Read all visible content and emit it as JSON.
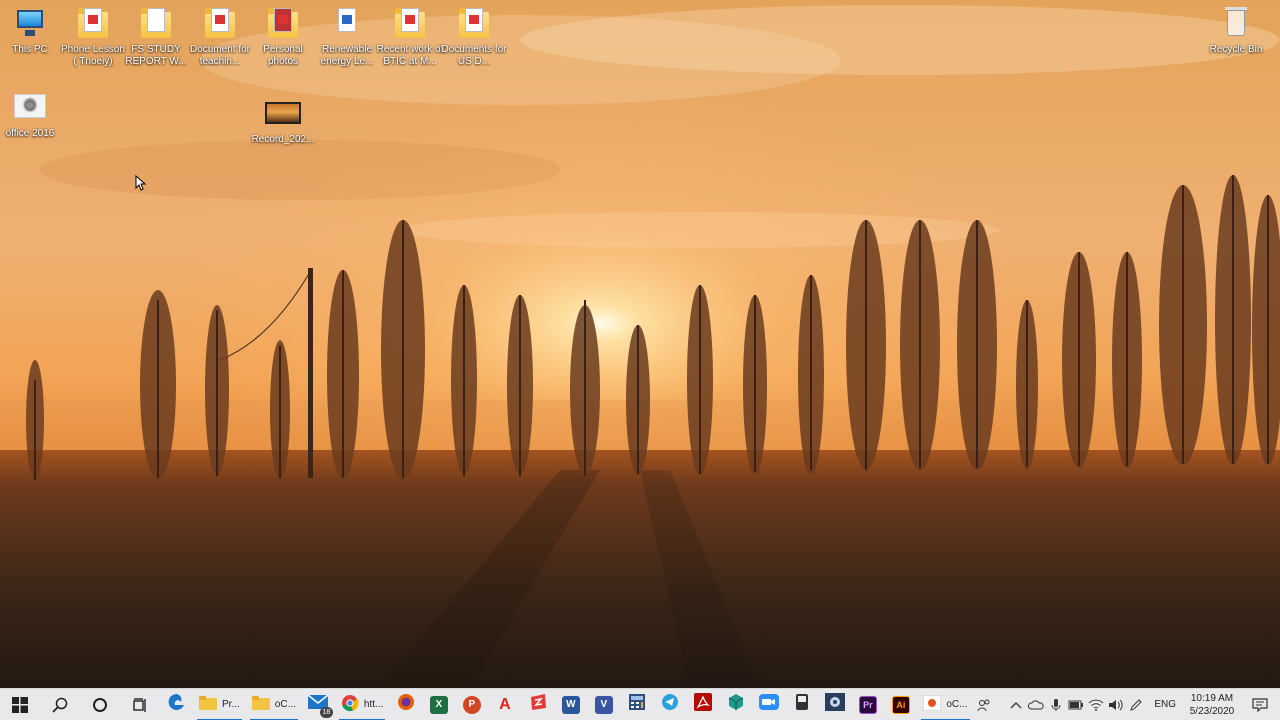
{
  "desktop": {
    "icons": [
      {
        "label": "This PC",
        "icon": "this-pc-icon"
      },
      {
        "label": "Phone Lesson ( Tnoeiy)",
        "icon": "pdf-document-icon"
      },
      {
        "label": "FS STUDY REPORT W...",
        "icon": "folder-icon"
      },
      {
        "label": "Document for teachin...",
        "icon": "pdf-document-icon"
      },
      {
        "label": "Personal photos",
        "icon": "photo-folder-icon"
      },
      {
        "label": "Renewable energy Le...",
        "icon": "word-document-icon"
      },
      {
        "label": "Recent work of BTIC at M...",
        "icon": "pdf-document-icon"
      },
      {
        "label": "Documents for US D...",
        "icon": "pdf-document-icon"
      },
      {
        "label": "office 2016",
        "icon": "office-setup-icon"
      },
      {
        "label": "Record_202...",
        "icon": "video-file-icon"
      },
      {
        "label": "Recycle Bin",
        "icon": "recycle-bin-icon"
      }
    ]
  },
  "taskbar": {
    "start": "windows-start-icon",
    "search": "search-icon",
    "cortana": "cortana-icon",
    "task_view": "task-view-icon",
    "apps": [
      {
        "name": "edge",
        "icon": "edge-icon",
        "color": "#1f76c9"
      },
      {
        "name": "file-explorer-1",
        "icon": "folder-icon",
        "label": "Pr...",
        "active": true
      },
      {
        "name": "file-explorer-2",
        "icon": "folder-icon",
        "label": "oC...",
        "active": true
      },
      {
        "name": "mail",
        "icon": "mail-icon",
        "badge": "18"
      },
      {
        "name": "chrome",
        "icon": "chrome-icon",
        "label": "htt...",
        "active": true
      },
      {
        "name": "firefox",
        "icon": "firefox-icon",
        "color": "#e66000"
      },
      {
        "name": "excel",
        "icon": "excel-icon",
        "color": "#1d6f42"
      },
      {
        "name": "powerpoint",
        "icon": "powerpoint-icon",
        "color": "#d24726"
      },
      {
        "name": "acrobat",
        "icon": "acrobat-icon",
        "color": "#e2231a"
      },
      {
        "name": "wps",
        "icon": "wps-icon",
        "color": "#e23b3b"
      },
      {
        "name": "word",
        "icon": "word-icon",
        "color": "#2b579a"
      },
      {
        "name": "visio",
        "icon": "visio-icon",
        "color": "#3955a3"
      },
      {
        "name": "calculator",
        "icon": "calculator-icon",
        "color": "#2f4f7f"
      },
      {
        "name": "telegram",
        "icon": "telegram-icon",
        "color": "#2aa1da"
      },
      {
        "name": "acrobat-reader",
        "icon": "acrobat-reader-icon",
        "color": "#b30b00"
      },
      {
        "name": "package",
        "icon": "package-icon",
        "color": "#1f9c8a"
      },
      {
        "name": "zoom",
        "icon": "zoom-icon",
        "color": "#2d8cff"
      },
      {
        "name": "usb-tool",
        "icon": "usb-tool-icon",
        "color": "#555555"
      },
      {
        "name": "media-tool",
        "icon": "media-tool-icon",
        "color": "#2b3d5c"
      },
      {
        "name": "premiere",
        "icon": "premiere-icon",
        "color": "#2a0a3d"
      },
      {
        "name": "illustrator",
        "icon": "illustrator-icon",
        "color": "#330000"
      },
      {
        "name": "photos",
        "icon": "photos-icon",
        "label": "oC...",
        "active": true
      }
    ],
    "letters": {
      "excel": "X",
      "powerpoint": "P",
      "acrobat": "A",
      "word": "W",
      "visio": "V",
      "premiere": "Pr",
      "illustrator": "Ai"
    },
    "tray": {
      "lang": "ENG",
      "time": "10:19 AM",
      "date": "5/23/2020"
    }
  }
}
